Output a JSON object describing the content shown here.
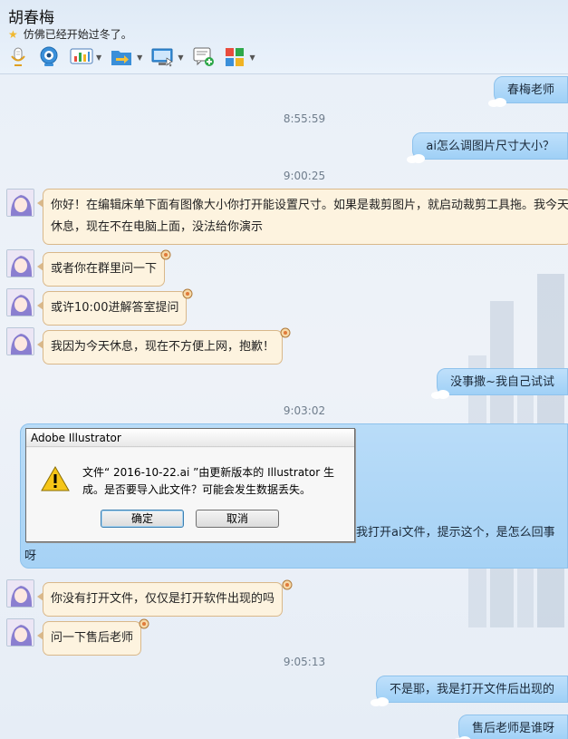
{
  "header": {
    "contact_name": "胡春梅",
    "signature": "仿佛已经开始过冬了。",
    "toolbar": [
      {
        "name": "microphone-icon",
        "dropdown": false
      },
      {
        "name": "webcam-icon",
        "dropdown": false
      },
      {
        "name": "chart-app-icon",
        "dropdown": true
      },
      {
        "name": "file-transfer-icon",
        "dropdown": true
      },
      {
        "name": "remote-desktop-icon",
        "dropdown": true
      },
      {
        "name": "new-message-icon",
        "dropdown": false
      },
      {
        "name": "apps-grid-icon",
        "dropdown": true
      }
    ]
  },
  "messages": {
    "m1": "春梅老师",
    "t1": "8:55:59",
    "m2": "ai怎么调图片尺寸大小？",
    "t2": "9:00:25",
    "m3_line1": "你好！在编辑床单下面有图像大小你打开能设置尺寸。如果是裁剪图片，就启动裁剪工具拖。我今天",
    "m3_line2": "休息，现在不在电脑上面，没法给你演示",
    "m4": "或者你在群里问一下",
    "m5": "或许10:00进解答室提问",
    "m6": "我因为今天休息，现在不方便上网，抱歉！",
    "m7": "没事撒~我自己试试",
    "t3": "9:03:02",
    "m8_line1": "我打开ai文件，提示这个，是怎么回事",
    "m8_line2": "呀",
    "m9": "你没有打开文件，仅仅是打开软件出现的吗",
    "m10": "问一下售后老师",
    "t4": "9:05:13",
    "m11": "不是耶，我是打开文件后出现的",
    "m12": "售后老师是谁呀"
  },
  "dialog": {
    "title": "Adobe Illustrator",
    "message": "文件“ 2016-10-22.ai ”由更新版本的 Illustrator 生成。是否要导入此文件？可能会发生数据丢失。",
    "ok_label": "确定",
    "cancel_label": "取消"
  },
  "colors": {
    "outgoing_bubble": "#a6d2f5",
    "incoming_bubble": "#fdf3df",
    "incoming_border": "#d9b88a",
    "timestamp": "#6f7d8c"
  }
}
